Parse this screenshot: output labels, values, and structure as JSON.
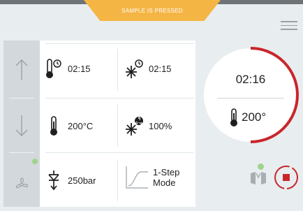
{
  "banner": {
    "text": "SAMPLE IS PRESSED"
  },
  "params": {
    "preheat_time": "02:15",
    "cooling_time": "02:15",
    "temperature": "200°C",
    "cooling_power": "100%",
    "pressure": "250bar",
    "mode_line1": "1-Step",
    "mode_line2": "Mode"
  },
  "status": {
    "elapsed": "02:16",
    "current_temp": "200°"
  },
  "colors": {
    "accent_red": "#c8262b",
    "banner_orange": "#f5b544",
    "indicator_green": "#9fd48a"
  },
  "icons": [
    "menu-icon",
    "arrow-up-icon",
    "arrow-down-icon",
    "fan-icon",
    "heating-timer-icon",
    "cooling-timer-icon",
    "thermometer-icon",
    "cooling-power-icon",
    "pressure-icon",
    "step-mode-icon",
    "mold-icon",
    "stop-icon"
  ]
}
